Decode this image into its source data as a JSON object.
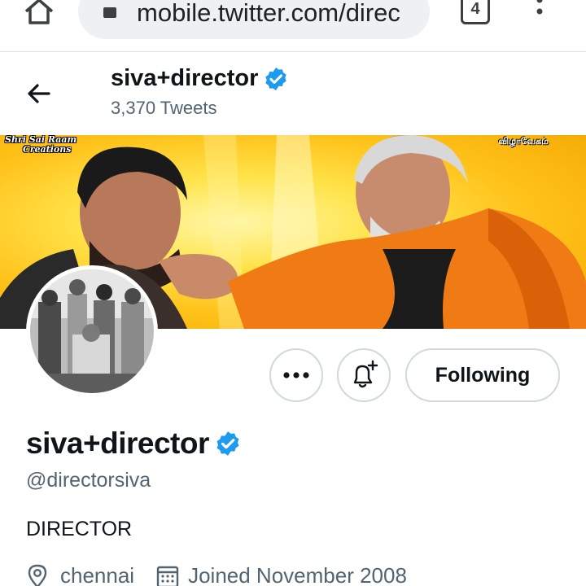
{
  "browser": {
    "url": "mobile.twitter.com/direc",
    "tab_count": "4"
  },
  "header": {
    "name": "siva+director",
    "tweet_count": "3,370 Tweets"
  },
  "banner": {
    "tag_left_line1": "Shri Sai Raam",
    "tag_left_line2": "Creations",
    "tag_right": "விழாவேகம்"
  },
  "actions": {
    "following_label": "Following"
  },
  "profile": {
    "name": "siva+director",
    "handle": "@directorsiva",
    "bio": "DIRECTOR",
    "location": "chennai",
    "joined": "Joined November 2008",
    "verified": true
  },
  "colors": {
    "verified_blue": "#1d9bf0",
    "muted_text": "#536471",
    "border": "#cfd9de"
  },
  "icons": [
    "home-icon",
    "lock-icon",
    "tabs-icon",
    "more-vert-icon",
    "back-arrow-icon",
    "verified-badge-icon",
    "more-horizontal-icon",
    "notification-bell-plus-icon",
    "location-pin-icon",
    "calendar-icon"
  ]
}
